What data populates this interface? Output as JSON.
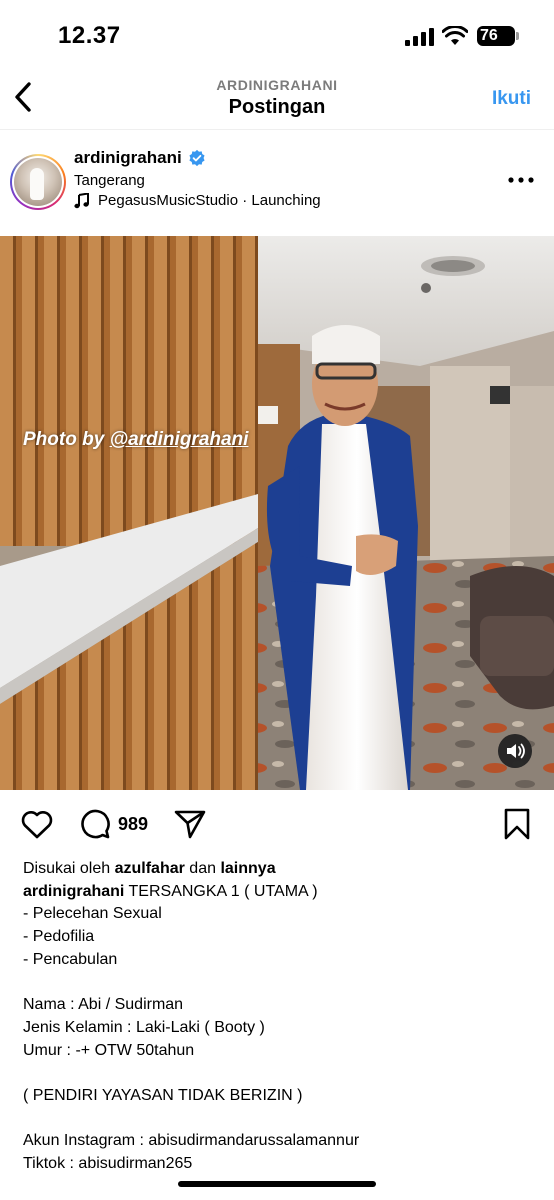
{
  "status_bar": {
    "time": "12.37",
    "battery": "76"
  },
  "header": {
    "subtitle": "ARDINIGRAHANI",
    "title": "Postingan",
    "follow_label": "Ikuti"
  },
  "post": {
    "username": "ardinigrahani",
    "verified": true,
    "location": "Tangerang",
    "music": "PegasusMusicStudio · Launching",
    "photo": {
      "overlay_prefix": "Photo by ",
      "overlay_handle": "@ardinigrahani"
    },
    "comments_count": "989"
  },
  "caption": {
    "likes_prefix": "Disukai oleh ",
    "likes_user": "azulfahar",
    "likes_middle": " dan ",
    "likes_others": "lainnya",
    "author": "ardinigrahani",
    "first_line": " TERSANGKA 1 ( UTAMA )",
    "lines": [
      "- Pelecehan Sexual",
      "- Pedofilia",
      "- Pencabulan",
      "",
      "Nama : Abi / Sudirman",
      "Jenis Kelamin : Laki-Laki ( Booty )",
      "Umur : -+ OTW 50tahun",
      "",
      "( PENDIRI YAYASAN TIDAK BERIZIN )",
      "",
      "Akun Instagram : abisudirmandarussalamannur",
      "Tiktok : abisudirman265"
    ]
  },
  "colors": {
    "accent": "#3897f0",
    "secondary_text": "#7c7c7c",
    "verified": "#3897f0"
  },
  "icons": [
    "chevron-left-icon",
    "verified-badge-icon",
    "music-note-icon",
    "more-horizontal-icon",
    "heart-icon",
    "comment-icon",
    "send-icon",
    "bookmark-icon",
    "speaker-icon"
  ]
}
